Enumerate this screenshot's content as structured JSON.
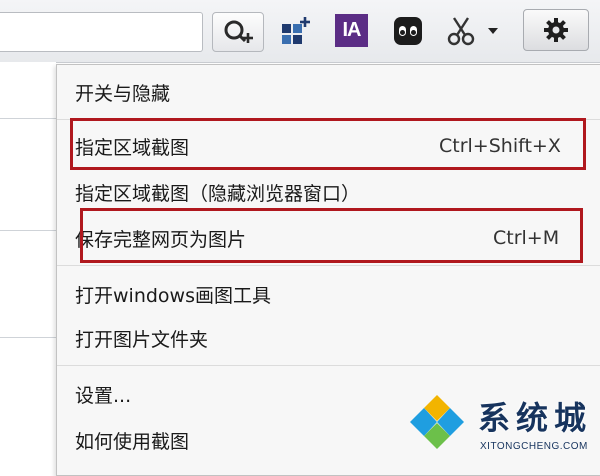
{
  "menu": {
    "items": [
      {
        "label": "开关与隐藏",
        "shortcut": ""
      },
      {
        "label": "指定区域截图",
        "shortcut": "Ctrl+Shift+X"
      },
      {
        "label": "指定区域截图（隐藏浏览器窗口）",
        "shortcut": ""
      },
      {
        "label": "保存完整网页为图片",
        "shortcut": "Ctrl+M"
      },
      {
        "label": "打开windows画图工具",
        "shortcut": ""
      },
      {
        "label": "打开图片文件夹",
        "shortcut": ""
      },
      {
        "label": "设置...",
        "shortcut": ""
      },
      {
        "label": "如何使用截图",
        "shortcut": ""
      }
    ]
  },
  "toolbar": {
    "ia_label": "IA",
    "icons": [
      "zoom-in-icon",
      "grid-plus-icon",
      "ia-icon",
      "ghost-icon",
      "scissors-icon",
      "chevron-down-icon",
      "gear-icon"
    ]
  },
  "watermark": {
    "title": "系统城",
    "subtitle": "XITONGCHENG.COM"
  },
  "colors": {
    "highlight_border": "#b0181e",
    "menu_background": "#f7f7f7",
    "ia_background": "#5b2d85",
    "watermark_text": "#17345e"
  }
}
